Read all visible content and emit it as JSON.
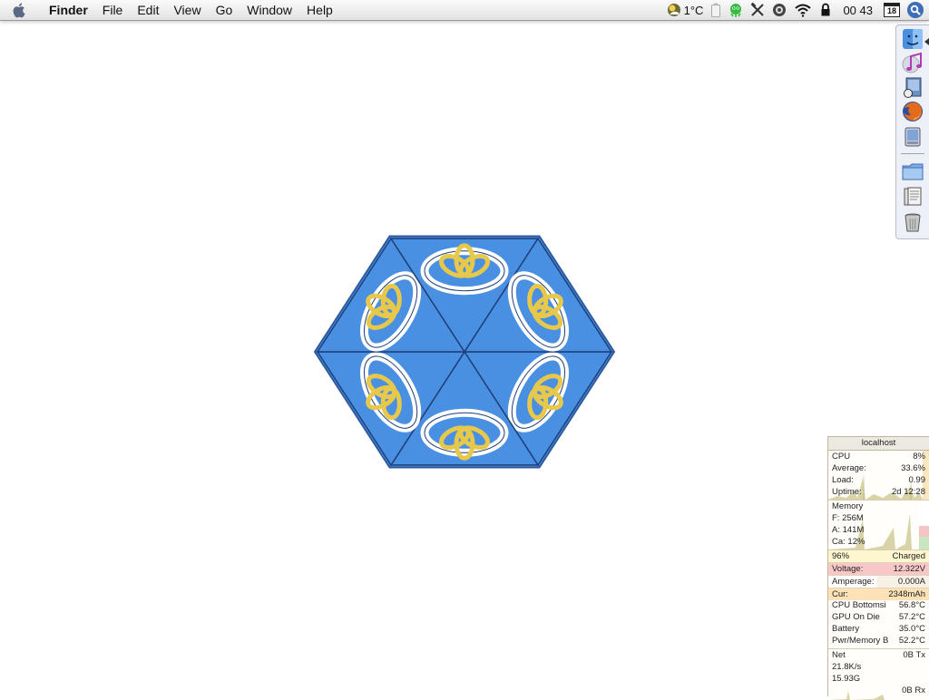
{
  "menubar": {
    "app_name": "Finder",
    "menus": [
      "File",
      "Edit",
      "View",
      "Go",
      "Window",
      "Help"
    ],
    "status": {
      "temperature": "1°C",
      "clock": "00 43",
      "calendar_day": "18"
    }
  },
  "dock": {
    "items": [
      "finder",
      "itunes",
      "preview",
      "firefox",
      "pda",
      "folder",
      "documents",
      "trash"
    ]
  },
  "monitor": {
    "host": "localhost",
    "cpu": {
      "label": "CPU",
      "value": "8%",
      "average_label": "Average:",
      "average": "33.6%",
      "load_label": "Load:",
      "load": "0.99",
      "uptime_label": "Uptime:",
      "uptime": "2d 12:28"
    },
    "memory": {
      "label": "Memory",
      "free": "F: 256M",
      "active": "A: 141M",
      "cache": "Ca: 12%"
    },
    "battery": {
      "percent": "96%",
      "state": "Charged",
      "voltage_label": "Voltage:",
      "voltage": "12.322V",
      "amperage_label": "Amperage:",
      "amperage": "0.000A",
      "current_label": "Cur:",
      "current": "2348mAh"
    },
    "temps": [
      {
        "label": "CPU Bottomsi",
        "value": "56.8°C"
      },
      {
        "label": "GPU On Die",
        "value": "57.2°C"
      },
      {
        "label": "Battery",
        "value": "35.0°C"
      },
      {
        "label": "Pwr/Memory B",
        "value": "52.2°C"
      }
    ],
    "net": {
      "label": "Net",
      "tx": "0B Tx",
      "rate": "21.8K/s",
      "total": "15.93G",
      "rx": "0B Rx"
    }
  },
  "colors": {
    "wallpaper_blue": "#4a90e2",
    "knot_gold": "#e8c84a",
    "menubar": "#f0f0f0"
  }
}
